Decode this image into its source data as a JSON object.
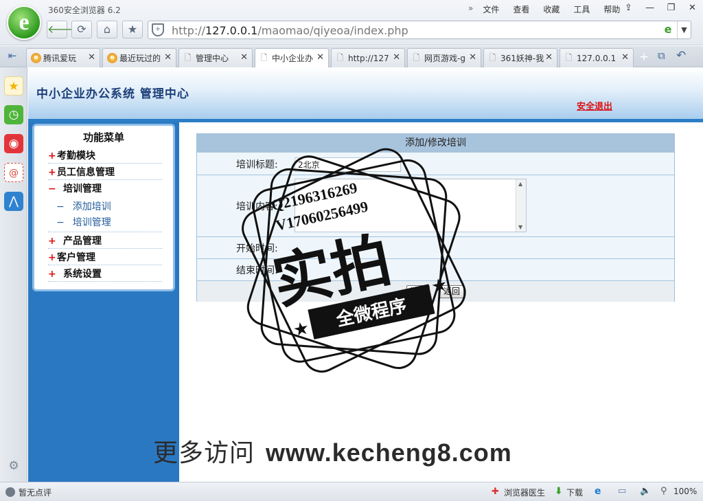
{
  "browser": {
    "title": "360安全浏览器 6.2",
    "logo_glyph": "e",
    "menu": [
      "文件",
      "查看",
      "收藏",
      "工具",
      "帮助"
    ],
    "menu_chevron": "»",
    "window_controls": [
      "⇪",
      "—",
      "❐",
      "✕"
    ],
    "nav": {
      "back": "🡐",
      "refresh": "⟳",
      "home": "⌂",
      "favorite": "★"
    },
    "url_scheme": "http://",
    "url_host": "127.0.0.1",
    "url_path": "/maomao/qiyeoa/index.php",
    "tabs": [
      {
        "label": "腾讯爱玩",
        "icon": "ie"
      },
      {
        "label": "最近玩过的",
        "icon": "ie"
      },
      {
        "label": "管理中心",
        "icon": "page"
      },
      {
        "label": "中小企业办",
        "icon": "page",
        "active": true
      },
      {
        "label": "http://127",
        "icon": "page"
      },
      {
        "label": "网页游戏-g",
        "icon": "page"
      },
      {
        "label": "361妖神-我",
        "icon": "page"
      },
      {
        "label": "127.0.0.1",
        "icon": "page"
      }
    ],
    "new_tab": "+",
    "status": {
      "rating": "暂无点评",
      "doctor": "浏览器医生",
      "download": "下载",
      "zoom": "100%"
    }
  },
  "page": {
    "site_title": "中小企业办公系统  管理中心",
    "logout": "安全退出",
    "menu_title": "功能菜单",
    "menu": [
      {
        "label": "考勤模块",
        "marker": "+"
      },
      {
        "label": "员工信息管理",
        "marker": "+"
      },
      {
        "label": "培训管理",
        "marker": "−",
        "children": [
          "添加培训",
          "培训管理"
        ]
      },
      {
        "label": "产品管理",
        "marker": "+"
      },
      {
        "label": "客户管理",
        "marker": "+"
      },
      {
        "label": "系统设置",
        "marker": "+"
      }
    ],
    "form": {
      "heading": "添加/修改培训",
      "title_label": "培训标题:",
      "title_value": "2北京",
      "content_label": "培训内容:",
      "start_label": "开始时间:",
      "end_label": "结束时间:",
      "submit": "提交",
      "back": "返回"
    }
  },
  "watermark": {
    "line1": "Q2196316269",
    "line2": "V17060256499",
    "main": "实拍",
    "banner": "全微程序",
    "site_prefix": "更多访问",
    "site_domain": "www.kecheng8.com"
  }
}
